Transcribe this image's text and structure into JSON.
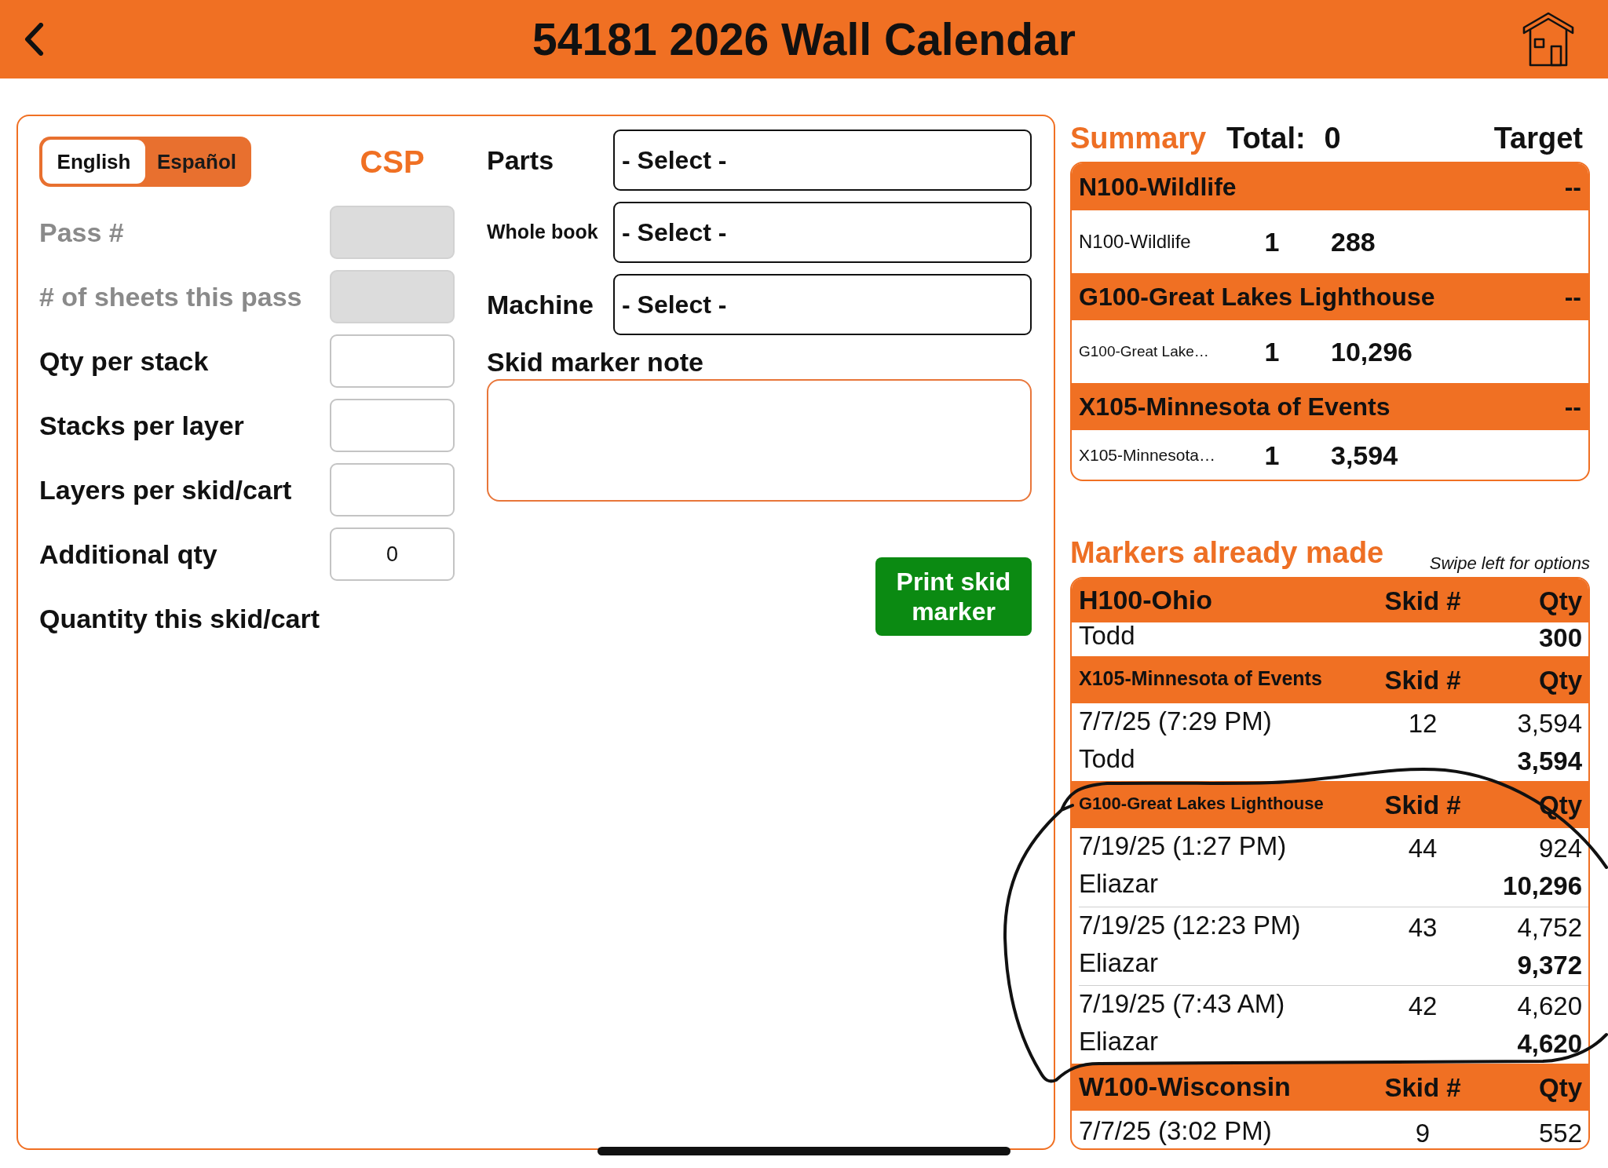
{
  "header": {
    "title": "54181 2026 Wall Calendar"
  },
  "languages": [
    {
      "label": "English",
      "selected": true
    },
    {
      "label": "Español",
      "selected": false
    }
  ],
  "mode_label": "CSP",
  "fields": [
    {
      "kind": "input",
      "label": "Pass #",
      "disabled": true
    },
    {
      "kind": "input",
      "label": "# of sheets this pass",
      "disabled": true
    },
    {
      "kind": "input",
      "label": "Qty per stack",
      "disabled": false
    },
    {
      "kind": "input",
      "label": "Stacks per layer",
      "disabled": false
    },
    {
      "kind": "input",
      "label": "Layers per skid/cart",
      "disabled": false
    },
    {
      "kind": "input",
      "label": "Additional qty",
      "disabled": false,
      "value": "0"
    },
    {
      "kind": "readout",
      "label": "Quantity this skid/cart"
    }
  ],
  "selects": [
    {
      "label": "Parts",
      "value": "- Select -"
    },
    {
      "label": "Whole book",
      "value": "- Select -"
    },
    {
      "label": "Machine",
      "value": "- Select -"
    }
  ],
  "note": {
    "label": "Skid marker note"
  },
  "print_button": {
    "label": "Print skid marker"
  },
  "summary": {
    "title": "Summary",
    "total_label": "Total:",
    "total_value": "0",
    "target_label": "Target",
    "groups": [
      {
        "title": "N100-Wildlife",
        "target": "--",
        "items": [
          {
            "name": "N100-Wildlife",
            "count": "1",
            "qty": "288"
          }
        ]
      },
      {
        "title": "G100-Great Lakes Lighthouse",
        "target": "--",
        "items": [
          {
            "name": "G100-Great Lake…",
            "count": "1",
            "qty": "10,296"
          }
        ]
      },
      {
        "title": "X105-Minnesota of Events",
        "target": "--",
        "items": [
          {
            "name": "X105-Minnesota…",
            "count": "1",
            "qty": "3,594"
          }
        ]
      }
    ]
  },
  "markers": {
    "title": "Markers already made",
    "hint": "Swipe left for options",
    "groups": [
      {
        "title": "H100-Ohio",
        "skid_header": "Skid #",
        "qty_header": "Qty",
        "rows": [
          {
            "name": "Todd",
            "total": "300"
          }
        ]
      },
      {
        "title": "X105-Minnesota of Events",
        "skid_header": "Skid #",
        "qty_header": "Qty",
        "rows": [
          {
            "date": "7/7/25 (7:29 PM)",
            "skid": "12",
            "qty": "3,594",
            "name": "Todd",
            "total": "3,594"
          }
        ]
      },
      {
        "title": "G100-Great Lakes Lighthouse",
        "skid_header": "Skid #",
        "qty_header": "Qty",
        "rows": [
          {
            "date": "7/19/25 (1:27 PM)",
            "skid": "44",
            "qty": "924",
            "name": "Eliazar",
            "total": "10,296"
          },
          {
            "date": "7/19/25 (12:23 PM)",
            "skid": "43",
            "qty": "4,752",
            "name": "Eliazar",
            "total": "9,372"
          },
          {
            "date": "7/19/25 (7:43 AM)",
            "skid": "42",
            "qty": "4,620",
            "name": "Eliazar",
            "total": "4,620"
          }
        ]
      },
      {
        "title": "W100-Wisconsin",
        "skid_header": "Skid #",
        "qty_header": "Qty",
        "rows": [
          {
            "date": "7/7/25 (3:02 PM)",
            "skid": "9",
            "qty": "552"
          }
        ]
      }
    ]
  }
}
